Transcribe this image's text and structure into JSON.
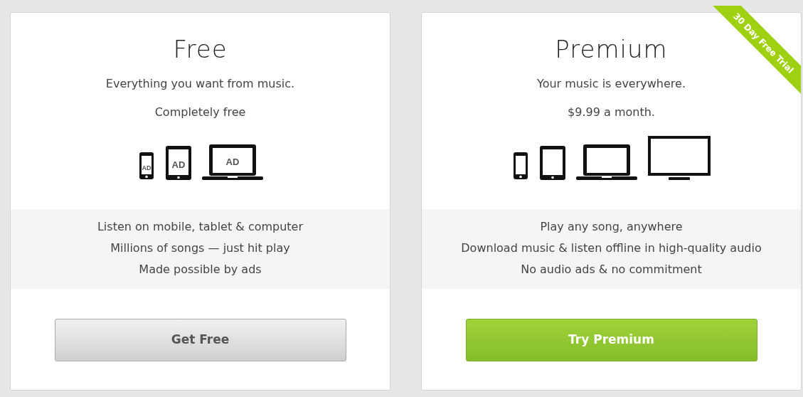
{
  "plans": [
    {
      "title": "Free",
      "tagline": "Everything you want from music.",
      "price": "Completely free",
      "devices": [
        {
          "kind": "phone",
          "screen_text": "AD"
        },
        {
          "kind": "tablet",
          "screen_text": "AD"
        },
        {
          "kind": "laptop",
          "screen_text": "AD"
        }
      ],
      "features": [
        "Listen on mobile, tablet & computer",
        "Millions of songs — just hit play",
        "Made possible by ads"
      ],
      "button": {
        "label": "Get Free",
        "kind": "plain"
      }
    },
    {
      "title": "Premium",
      "tagline": "Your music is everywhere.",
      "price": "$9.99 a month.",
      "ribbon": "30 Day Free Trial",
      "devices": [
        {
          "kind": "phone"
        },
        {
          "kind": "tablet"
        },
        {
          "kind": "laptop"
        },
        {
          "kind": "tv"
        }
      ],
      "features": [
        "Play any song, anywhere",
        "Download music & listen offline in high-quality audio",
        "No audio ads & no commitment"
      ],
      "button": {
        "label": "Try Premium",
        "kind": "primary"
      }
    }
  ]
}
